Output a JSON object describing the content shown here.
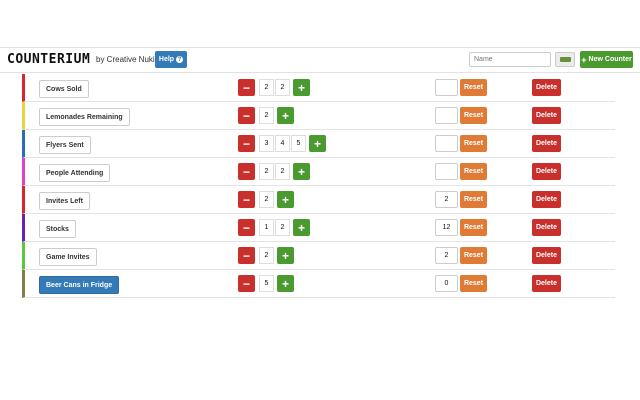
{
  "header": {
    "logo": "COUNTERIUM",
    "byline": "by Creative Nukin",
    "help_label": "Help",
    "name_placeholder": "Name",
    "new_counter_label": "New Counter"
  },
  "row_labels": {
    "reset": "Reset",
    "delete": "Delete"
  },
  "counters": [
    {
      "label": "Cows Sold",
      "digits": [
        "2",
        "2"
      ],
      "reset_value": "",
      "color": "#d9262a",
      "active": false
    },
    {
      "label": "Lemonades Remaining",
      "digits": [
        "2"
      ],
      "reset_value": "",
      "color": "#e8d63a",
      "active": false
    },
    {
      "label": "Flyers Sent",
      "digits": [
        "3",
        "4",
        "5"
      ],
      "reset_value": "",
      "color": "#2a6db5",
      "active": false
    },
    {
      "label": "People Attending",
      "digits": [
        "2",
        "2"
      ],
      "reset_value": "",
      "color": "#e040c8",
      "active": false
    },
    {
      "label": "Invites Left",
      "digits": [
        "2"
      ],
      "reset_value": "2",
      "color": "#d9262a",
      "active": false
    },
    {
      "label": "Stocks",
      "digits": [
        "1",
        "2"
      ],
      "reset_value": "12",
      "color": "#6a22b5",
      "active": false
    },
    {
      "label": "Game Invites",
      "digits": [
        "2"
      ],
      "reset_value": "2",
      "color": "#5ac83a",
      "active": false
    },
    {
      "label": "Beer Cans in Fridge",
      "digits": [
        "5"
      ],
      "reset_value": "0",
      "color": "#8a7a4a",
      "active": true
    }
  ]
}
